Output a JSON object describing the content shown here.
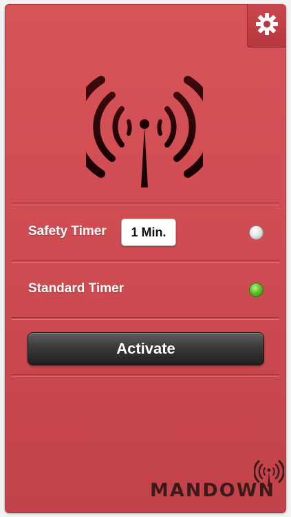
{
  "header": {
    "settings_icon": "gear-icon"
  },
  "hero": {
    "icon": "antenna-signal-icon"
  },
  "timers": {
    "safety": {
      "label": "Safety Timer",
      "value": "1 Min.",
      "selected": false
    },
    "standard": {
      "label": "Standard Timer",
      "selected": true
    }
  },
  "actions": {
    "activate_label": "Activate"
  },
  "brand": {
    "name": "MANDOWN",
    "icon": "antenna-signal-icon"
  },
  "colors": {
    "panel": "#cf4d52",
    "button": "#2b2b2b",
    "radio_on": "#5fbf2d",
    "radio_off": "#e6e6e6",
    "brand_text": "#3a1a1a"
  }
}
